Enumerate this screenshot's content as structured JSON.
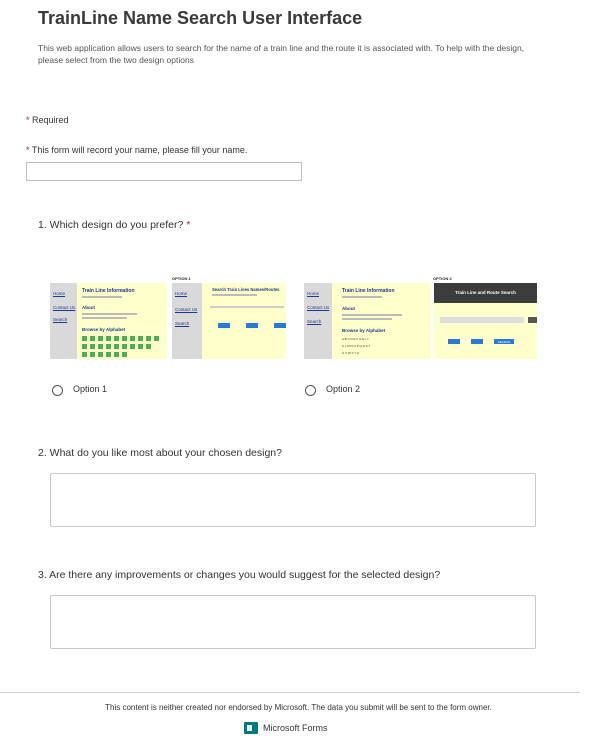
{
  "header": {
    "title": "TrainLine Name Search User Interface",
    "description": "This web application allows users to search for the name of a train line and the route it is associated with. To help with the design, please select from the two design options"
  },
  "form": {
    "required_star": "*",
    "required_label": "Required",
    "name_note": "This form will record your name, please fill your name.",
    "name_value": ""
  },
  "questions": {
    "q1": {
      "label": "1. Which design do you prefer?",
      "star": "*"
    },
    "q2": {
      "label": "2. What do you like most about your chosen design?"
    },
    "q3": {
      "label": "3. Are there any improvements or changes you would suggest for the selected design?"
    }
  },
  "options": [
    {
      "label": "Option 1",
      "caption": "OPTION 1",
      "screen1": {
        "links": [
          "Home",
          "Contact Us",
          "Search"
        ],
        "title": "Train Line Information",
        "about": "About",
        "browse": "Browse by Alphabet"
      },
      "screen2": {
        "links": [
          "Home",
          "Contact Us",
          "Search"
        ],
        "title": "Search Train Lines Names/Routes"
      }
    },
    {
      "label": "Option 2",
      "caption": "OPTION 2",
      "screen1": {
        "links": [
          "Home",
          "Contact Us",
          "Search"
        ],
        "title": "Train Line Information",
        "about": "About",
        "browse": "Browse by Alphabet",
        "letters": [
          "A B C D E F G H I J",
          "K L M N O P Q R S T",
          "U V W X Y Z"
        ]
      },
      "screen2": {
        "title": "Train Line and Route Search",
        "search_button": "SEARCH"
      }
    }
  ],
  "answers": {
    "q2": "",
    "q3": ""
  },
  "footer": {
    "disclaimer": "This content is neither created nor endorsed by Microsoft. The data you submit will be sent to the form owner.",
    "brand": "Microsoft Forms"
  },
  "colors": {
    "required": "#a4262c",
    "brand": "#03787c",
    "link": "#1a3a8f",
    "button": "#2a7ad4"
  }
}
